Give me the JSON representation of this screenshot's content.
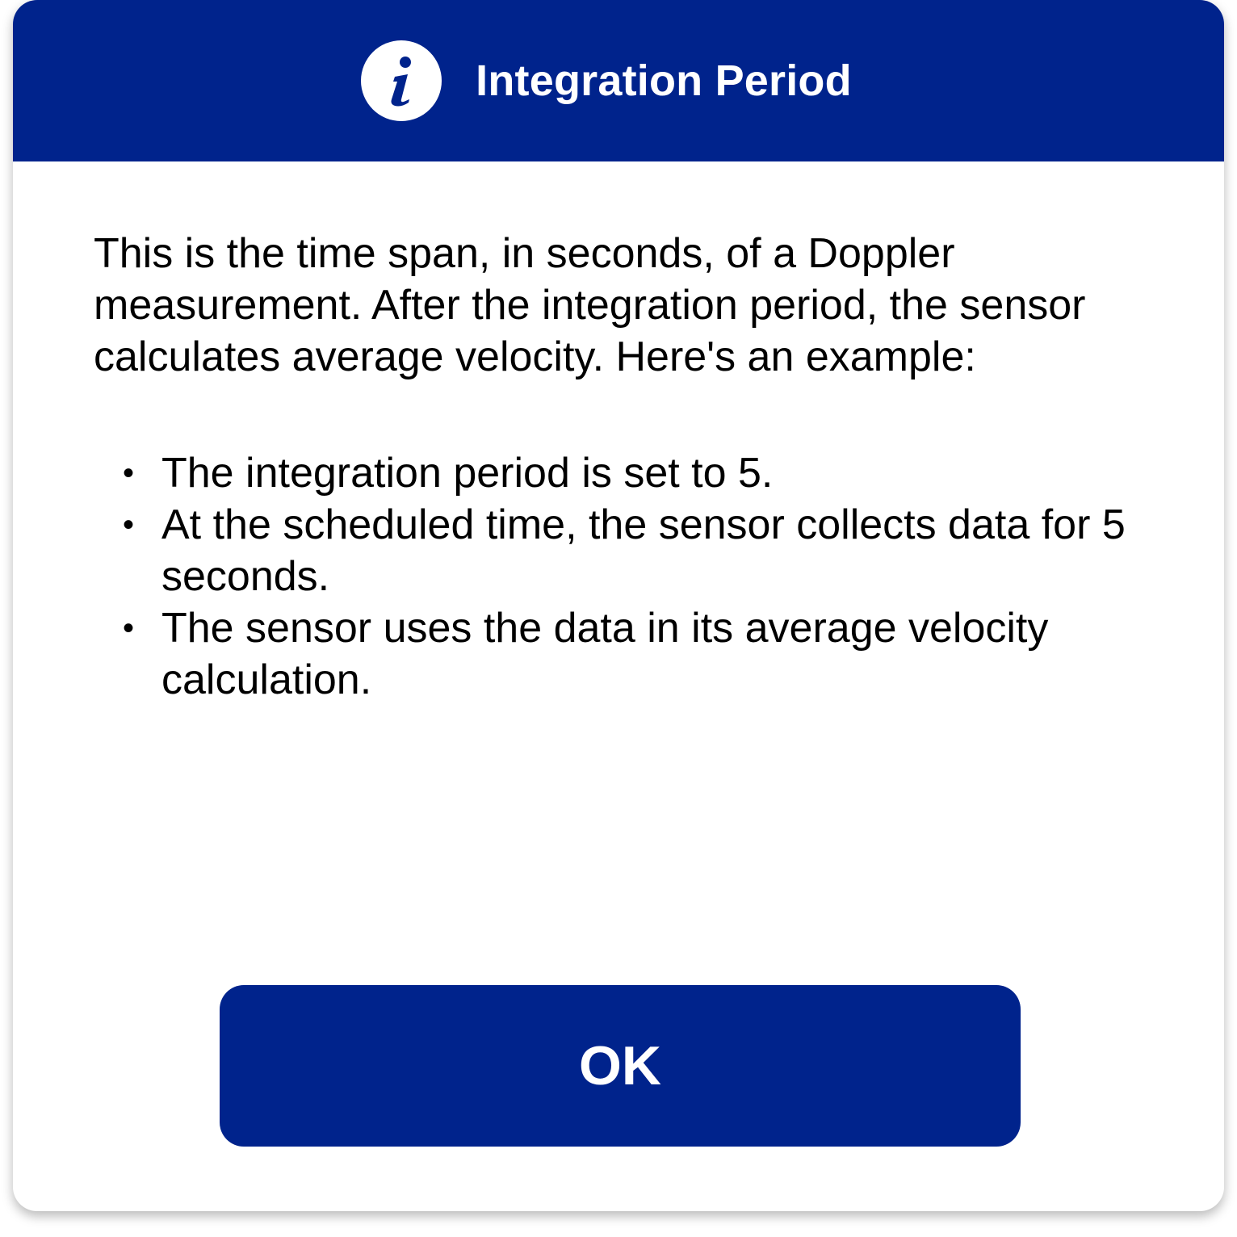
{
  "dialog": {
    "title": "Integration Period",
    "icon": "info-icon",
    "intro": "This is the time span, in seconds, of a Doppler measurement. After the integration period, the sensor calculates average velocity. Here's an example:",
    "bullets": [
      "The integration period is set to 5.",
      "At the scheduled time, the sensor collects data for 5 seconds.",
      "The sensor uses the data in its average velocity calculation."
    ],
    "ok_label": "OK"
  },
  "colors": {
    "accent": "#00238c",
    "background": "#ffffff",
    "text": "#000000"
  }
}
